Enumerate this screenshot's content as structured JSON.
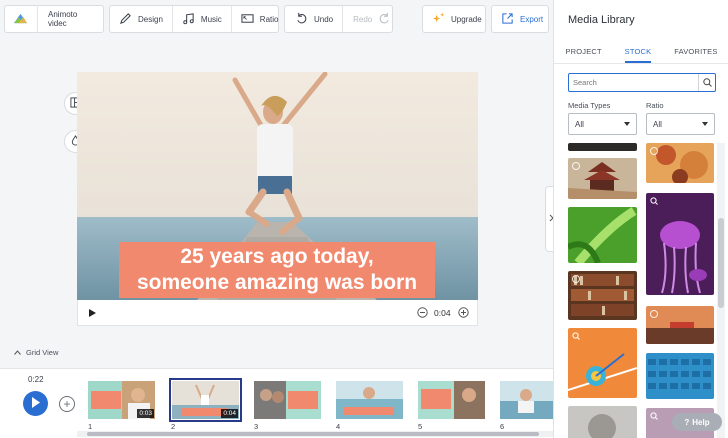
{
  "toolbar": {
    "animoto_label": "Animoto videc",
    "design_label": "Design",
    "music_label": "Music",
    "ratio_label": "Ratio",
    "undo_label": "Undo",
    "redo_label": "Redo",
    "upgrade_label": "Upgrade",
    "export_label": "Export"
  },
  "panel": {
    "title": "Media Library",
    "tabs": [
      {
        "label": "PROJECT"
      },
      {
        "label": "STOCK"
      },
      {
        "label": "FAVORITES"
      }
    ],
    "search_placeholder": "Search",
    "media_types_label": "Media Types",
    "media_types_value": "All",
    "ratio_label": "Ratio",
    "ratio_value": "All",
    "help_label": "Help"
  },
  "canvas": {
    "caption_line1": "25 years ago today,",
    "caption_line2": "someone amazing was born",
    "duration": "0:04"
  },
  "grid_view_label": "Grid View",
  "timeline": {
    "current_time": "0:22",
    "clips": [
      {
        "number": "1",
        "duration": "0:03"
      },
      {
        "number": "2",
        "duration": "0:04"
      },
      {
        "number": "3",
        "duration": ""
      },
      {
        "number": "4",
        "duration": ""
      },
      {
        "number": "5",
        "duration": ""
      },
      {
        "number": "6",
        "duration": ""
      }
    ]
  },
  "colors": {
    "accent": "#2a6ed2",
    "caption_bg": "#f1896e"
  }
}
